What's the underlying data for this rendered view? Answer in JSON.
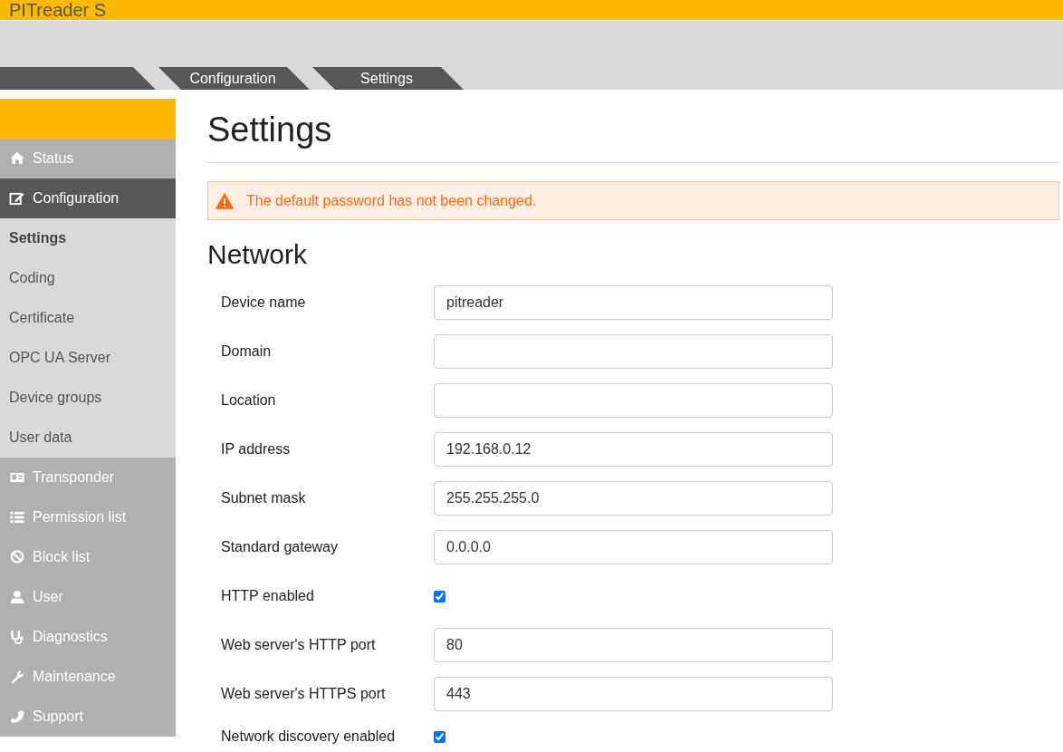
{
  "app": {
    "title": "PITreader S"
  },
  "breadcrumb": [
    "Configuration",
    "Settings"
  ],
  "sidebar": {
    "items": [
      {
        "kind": "main",
        "label": "Status",
        "selected": false
      },
      {
        "kind": "main",
        "label": "Configuration",
        "selected": true
      },
      {
        "kind": "sub",
        "label": "Settings",
        "selected": true
      },
      {
        "kind": "sub",
        "label": "Coding",
        "selected": false
      },
      {
        "kind": "sub",
        "label": "Certificate",
        "selected": false
      },
      {
        "kind": "sub",
        "label": "OPC UA Server",
        "selected": false
      },
      {
        "kind": "sub",
        "label": "Device groups",
        "selected": false
      },
      {
        "kind": "sub",
        "label": "User data",
        "selected": false
      },
      {
        "kind": "main",
        "label": "Transponder",
        "selected": false
      },
      {
        "kind": "main",
        "label": "Permission list",
        "selected": false
      },
      {
        "kind": "main",
        "label": "Block list",
        "selected": false
      },
      {
        "kind": "main",
        "label": "User",
        "selected": false
      },
      {
        "kind": "main",
        "label": "Diagnostics",
        "selected": false
      },
      {
        "kind": "main",
        "label": "Maintenance",
        "selected": false
      },
      {
        "kind": "main",
        "label": "Support",
        "selected": false
      }
    ]
  },
  "page": {
    "title": "Settings",
    "alert": {
      "text": "The default password has not been changed."
    },
    "section": "Network",
    "fields": [
      {
        "kind": "text",
        "label": "Device name",
        "value": "pitreader"
      },
      {
        "kind": "text",
        "label": "Domain"
      },
      {
        "kind": "text",
        "label": "Location"
      },
      {
        "kind": "text",
        "label": "IP address",
        "value": "192.168.0.12"
      },
      {
        "kind": "text",
        "label": "Subnet mask",
        "value": "255.255.255.0"
      },
      {
        "kind": "text",
        "label": "Standard gateway",
        "value": "0.0.0.0"
      },
      {
        "kind": "checkbox",
        "label": "HTTP enabled",
        "checked": true
      },
      {
        "kind": "text",
        "label": "Web server's HTTP port",
        "value": "80"
      },
      {
        "kind": "text",
        "label": "Web server's HTTPS port",
        "value": "443"
      },
      {
        "kind": "checkbox",
        "label": "Network discovery enabled",
        "checked": true
      }
    ]
  }
}
